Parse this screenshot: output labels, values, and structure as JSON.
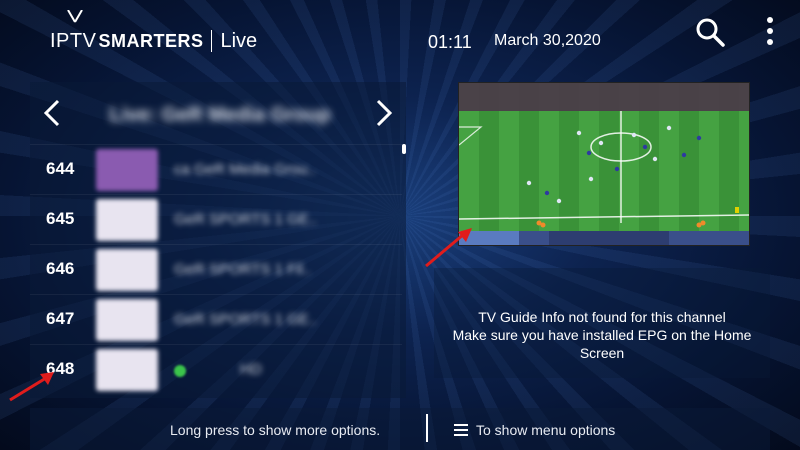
{
  "header": {
    "brand_iptv": "IPTV",
    "brand_smarters": "SMARTERS",
    "section": "Live",
    "time": "01:11",
    "date": "March 30,2020"
  },
  "channel_list": {
    "group_title": "Live: GeR Media Group",
    "channels": [
      {
        "number": "644",
        "name": "ca GeR Media Grou..",
        "logo_color": "#8a5bb0"
      },
      {
        "number": "645",
        "name": "GeR SPORTS 1 GE..",
        "logo_color": "#e8e4f0"
      },
      {
        "number": "646",
        "name": "GeR SPORTS 1 Fil..",
        "logo_color": "#e8e4f0"
      },
      {
        "number": "647",
        "name": "GeR SPORTS 1 GE..",
        "logo_color": "#e8e4f0"
      },
      {
        "number": "648",
        "name": "HD",
        "logo_color": "#e8e4f0"
      }
    ]
  },
  "epg": {
    "line1": "TV Guide Info not found for this channel",
    "line2": "Make sure you have installed EPG on the Home",
    "line3": "Screen"
  },
  "footer": {
    "long_press_hint": "Long press to show more options.",
    "menu_hint": "To show menu options"
  },
  "colors": {
    "background": "#0d2350",
    "pitch": "#3f9a3c",
    "arrow": "#e01c1c"
  }
}
